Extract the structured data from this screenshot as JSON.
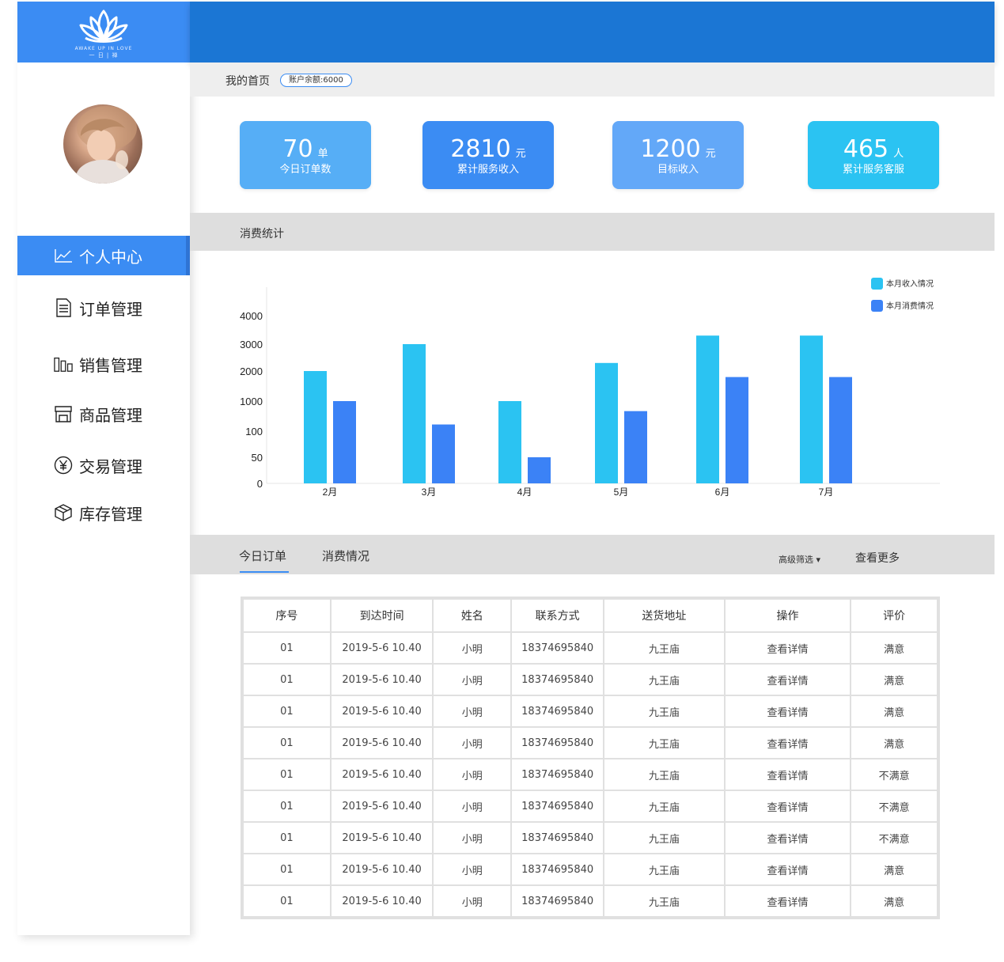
{
  "brand": {
    "logo_icon": "lotus-icon",
    "tagline": "AWAKE UP IN LOVE",
    "name_small": "一 日 | 禅",
    "color": "#3b8cf3"
  },
  "user": {
    "avatar_icon": "avatar-photo"
  },
  "sidebar": {
    "items": [
      {
        "label": "个人中心",
        "icon": "line-chart-icon",
        "active": true
      },
      {
        "label": "订单管理",
        "icon": "document-icon",
        "active": false
      },
      {
        "label": "销售管理",
        "icon": "bar-columns-icon",
        "active": false
      },
      {
        "label": "商品管理",
        "icon": "store-icon",
        "active": false
      },
      {
        "label": "交易管理",
        "icon": "yen-coin-icon",
        "active": false
      },
      {
        "label": "库存管理",
        "icon": "box-icon",
        "active": false
      }
    ]
  },
  "breadcrumb": {
    "title": "我的首页",
    "balance": "账户余额:6000"
  },
  "stats": [
    {
      "value": "70",
      "unit": "单",
      "label": "今日订单数",
      "color": "#56aef6"
    },
    {
      "value": "2810",
      "unit": "元",
      "label": "累计服务收入",
      "color": "#3b8cf3"
    },
    {
      "value": "1200",
      "unit": "元",
      "label": "目标收入",
      "color": "#63a8f8"
    },
    {
      "value": "465",
      "unit": "人",
      "label": "累计服务客服",
      "color": "#2bc3f2"
    }
  ],
  "consumption_section": {
    "title": "消费统计"
  },
  "chart_data": {
    "type": "bar",
    "categories": [
      "2月",
      "3月",
      "4月",
      "5月",
      "6月",
      "7月"
    ],
    "y_ticks": [
      "0",
      "50",
      "100",
      "1000",
      "2000",
      "3000",
      "4000"
    ],
    "series": [
      {
        "name": "本月收入情况",
        "color": "#2bc3f2",
        "values": [
          2000,
          3000,
          1000,
          2300,
          3300,
          3300
        ]
      },
      {
        "name": "本月消费情况",
        "color": "#3b82f6",
        "values": [
          1000,
          300,
          50,
          700,
          1800,
          1800
        ]
      }
    ],
    "legend": "top-right",
    "grid": false
  },
  "orders_section": {
    "tabs": [
      "今日订单",
      "消费情况"
    ],
    "active_tab": "今日订单",
    "filter_label": "高级筛选 ▾",
    "more_label": "查看更多"
  },
  "orders_table": {
    "columns": [
      "序号",
      "到达时间",
      "姓名",
      "联系方式",
      "送货地址",
      "操作",
      "评价"
    ],
    "rows": [
      [
        "01",
        "2019-5-6  10.40",
        "小明",
        "18374695840",
        "九王庙",
        "查看详情",
        "满意"
      ],
      [
        "01",
        "2019-5-6  10.40",
        "小明",
        "18374695840",
        "九王庙",
        "查看详情",
        "满意"
      ],
      [
        "01",
        "2019-5-6  10.40",
        "小明",
        "18374695840",
        "九王庙",
        "查看详情",
        "满意"
      ],
      [
        "01",
        "2019-5-6  10.40",
        "小明",
        "18374695840",
        "九王庙",
        "查看详情",
        "满意"
      ],
      [
        "01",
        "2019-5-6  10.40",
        "小明",
        "18374695840",
        "九王庙",
        "查看详情",
        "不满意"
      ],
      [
        "01",
        "2019-5-6  10.40",
        "小明",
        "18374695840",
        "九王庙",
        "查看详情",
        "不满意"
      ],
      [
        "01",
        "2019-5-6  10.40",
        "小明",
        "18374695840",
        "九王庙",
        "查看详情",
        "不满意"
      ],
      [
        "01",
        "2019-5-6  10.40",
        "小明",
        "18374695840",
        "九王庙",
        "查看详情",
        "满意"
      ],
      [
        "01",
        "2019-5-6  10.40",
        "小明",
        "18374695840",
        "九王庙",
        "查看详情",
        "满意"
      ]
    ]
  }
}
